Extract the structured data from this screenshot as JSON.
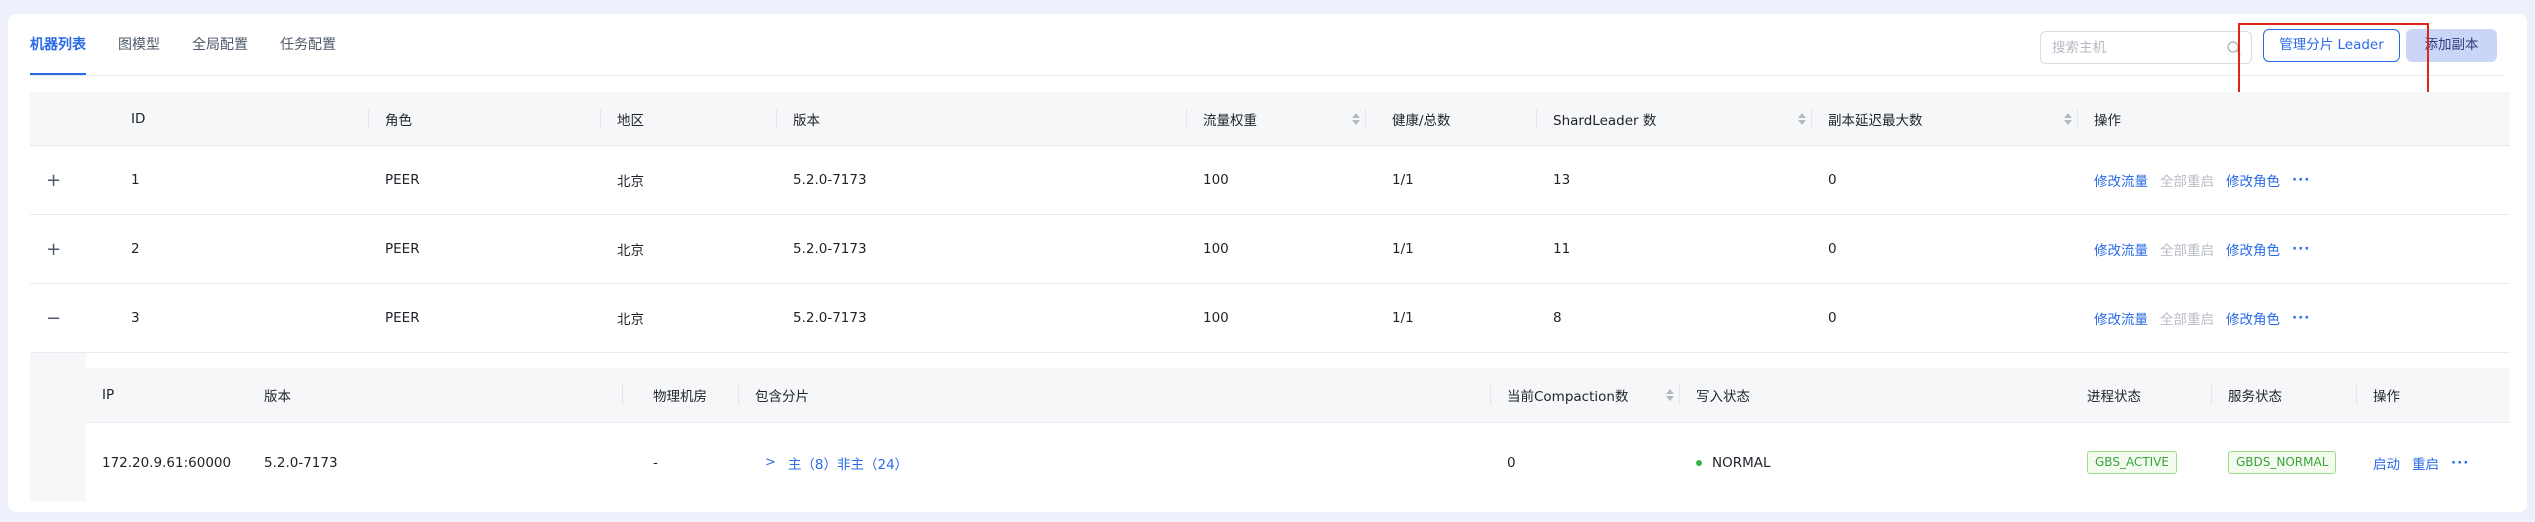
{
  "tabs": [
    "机器列表",
    "图模型",
    "全局配置",
    "任务配置"
  ],
  "search": {
    "placeholder": "搜索主机"
  },
  "buttons": {
    "manage_leader": "管理分片 Leader",
    "add_replica": "添加副本"
  },
  "table": {
    "headers": {
      "id": "ID",
      "role": "角色",
      "region": "地区",
      "version": "版本",
      "weight": "流量权重",
      "health": "健康/总数",
      "shard_leader": "ShardLeader 数",
      "max_delay": "副本延迟最大数",
      "ops": "操作"
    },
    "rows": [
      {
        "expand": "+",
        "id": "1",
        "role": "PEER",
        "region": "北京",
        "version": "5.2.0-7173",
        "weight": "100",
        "health": "1/1",
        "shard_leader": "13",
        "max_delay": "0"
      },
      {
        "expand": "+",
        "id": "2",
        "role": "PEER",
        "region": "北京",
        "version": "5.2.0-7173",
        "weight": "100",
        "health": "1/1",
        "shard_leader": "11",
        "max_delay": "0"
      },
      {
        "expand": "−",
        "id": "3",
        "role": "PEER",
        "region": "北京",
        "version": "5.2.0-7173",
        "weight": "100",
        "health": "1/1",
        "shard_leader": "8",
        "max_delay": "0"
      }
    ],
    "actions": {
      "modify_traffic": "修改流量",
      "restart_all": "全部重启",
      "modify_role": "修改角色",
      "more": "···"
    }
  },
  "subtable": {
    "headers": {
      "ip": "IP",
      "version": "版本",
      "room": "物理机房",
      "shards": "包含分片",
      "compaction": "当前Compaction数",
      "write_status": "写入状态",
      "process_status": "进程状态",
      "service_status": "服务状态",
      "ops": "操作"
    },
    "row": {
      "ip": "172.20.9.61:60000",
      "version": "5.2.0-7173",
      "room": "-",
      "shards_chevron": ">",
      "shards": "主（8）非主（24）",
      "compaction": "0",
      "write_status": "NORMAL",
      "process_status": "GBS_ACTIVE",
      "service_status": "GBDS_NORMAL",
      "start": "启动",
      "restart": "重启",
      "more": "···"
    }
  },
  "colors": {
    "accent": "#2a6ae6",
    "annotation": "#e2231a",
    "status_green": "#37b24d"
  }
}
